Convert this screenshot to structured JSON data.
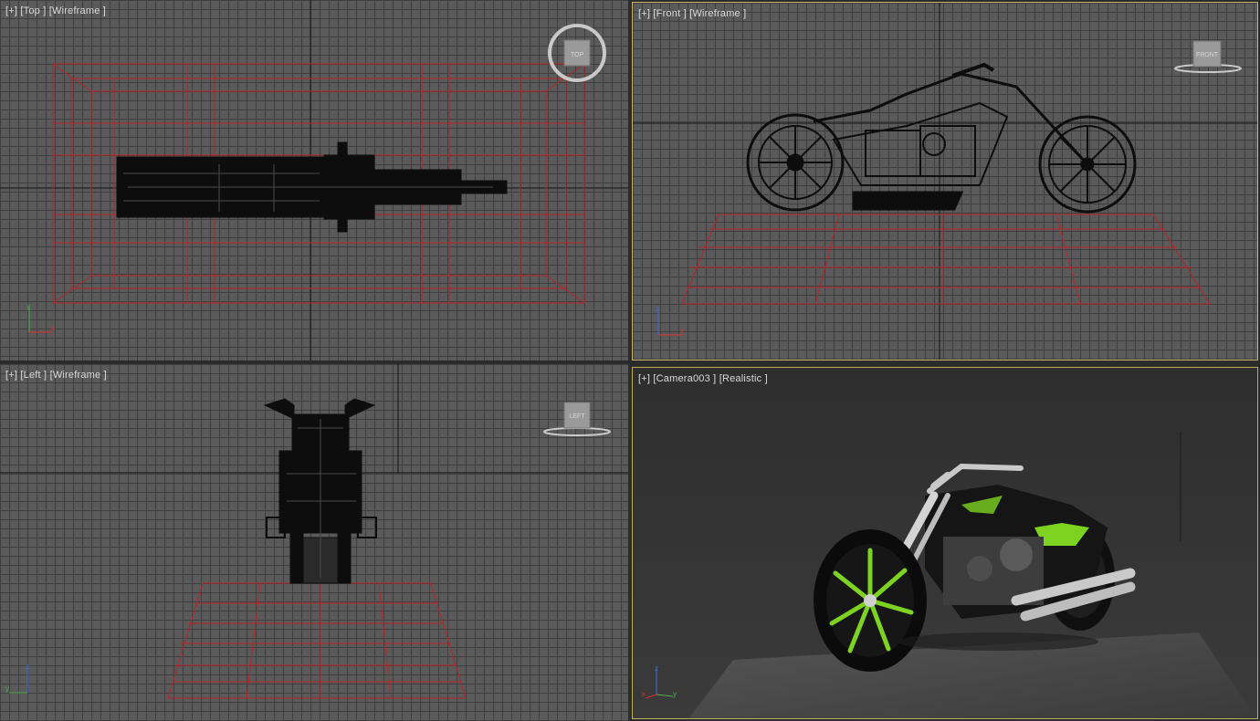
{
  "viewports": {
    "top": {
      "label": "[+] [Top ] [Wireframe ]",
      "cube_text": "TOP"
    },
    "front": {
      "label": "[+] [Front ] [Wireframe ]",
      "cube_text": "FRONT"
    },
    "left": {
      "label": "[+] [Left ] [Wireframe ]",
      "cube_text": "LEFT"
    },
    "camera": {
      "label": "[+] [Camera003 ] [Realistic ]"
    }
  },
  "axes": {
    "top": {
      "v": "y",
      "h": "x"
    },
    "front": {
      "v": "z",
      "h": "x"
    },
    "left": {
      "v": "z",
      "h": "y"
    },
    "camera": {
      "v": "z",
      "a": "x",
      "b": "y"
    }
  },
  "colors": {
    "grid_bg": "#5a5a5a",
    "grid_line": "#3f3f3f",
    "wire_red": "#b5262a",
    "model_black": "#0d0d0d",
    "active_border": "#c8b56a",
    "accent_green": "#7ed321"
  }
}
